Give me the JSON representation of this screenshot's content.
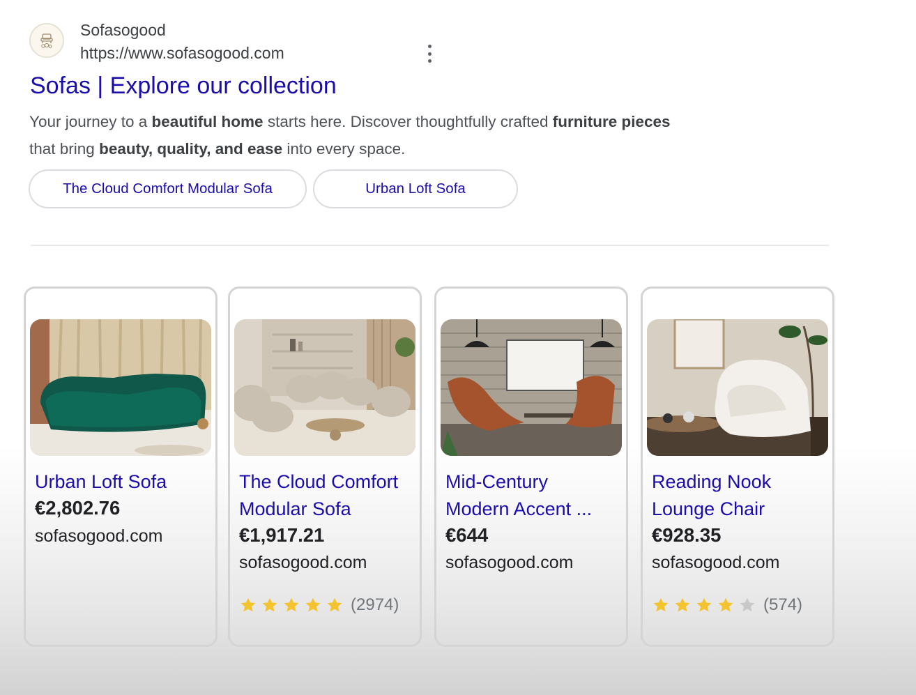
{
  "result": {
    "site_name": "Sofasogood",
    "url": "https://www.sofasogood.com",
    "title": "Sofas | Explore our collection",
    "snippet": {
      "line1": [
        {
          "t": "Your journey to a ",
          "b": false
        },
        {
          "t": "beautiful home",
          "b": true
        },
        {
          "t": " starts here. Discover thoughtfully crafted ",
          "b": false
        },
        {
          "t": "furniture pieces",
          "b": true
        }
      ],
      "line2": [
        {
          "t": "that bring ",
          "b": false
        },
        {
          "t": "beauty, quality, and ease",
          "b": true
        },
        {
          "t": " into every space.",
          "b": false
        }
      ]
    },
    "sitelinks": [
      "The Cloud Comfort Modular Sofa",
      "Urban Loft Sofa"
    ]
  },
  "products": [
    {
      "name_lines": [
        "Urban Loft Sofa"
      ],
      "price": "€2,802.76",
      "domain": "sofasogood.com",
      "rating": null,
      "reviews": null
    },
    {
      "name_lines": [
        "The Cloud Comfort",
        "Modular Sofa"
      ],
      "price": "€1,917.21",
      "domain": "sofasogood.com",
      "rating": 5,
      "reviews": "(2974)"
    },
    {
      "name_lines": [
        "Mid-Century",
        "Modern Accent ..."
      ],
      "price": "€644",
      "domain": "sofasogood.com",
      "rating": null,
      "reviews": null
    },
    {
      "name_lines": [
        "Reading Nook",
        "Lounge Chair"
      ],
      "price": "€928.35",
      "domain": "sofasogood.com",
      "rating": 4,
      "reviews": "(574)"
    }
  ],
  "colors": {
    "link": "#1a0dab",
    "star_filled": "#f4c430",
    "star_empty": "#c8c8c8"
  },
  "icons": [
    "favicon-logo",
    "more-vert-icon",
    "star-icon"
  ]
}
